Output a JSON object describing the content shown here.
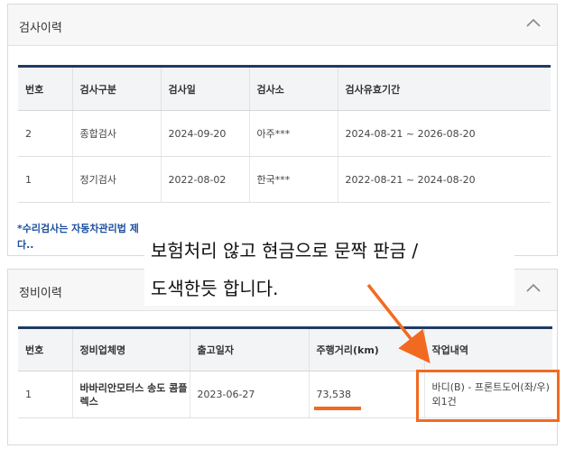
{
  "inspection": {
    "title": "검사이력",
    "columns": [
      "번호",
      "검사구분",
      "검사일",
      "검사소",
      "검사유효기간"
    ],
    "rows": [
      {
        "no": "2",
        "type": "종합검사",
        "date": "2024-09-20",
        "station": "아주***",
        "valid": "2024-08-21 ~ 2026-08-20"
      },
      {
        "no": "1",
        "type": "정기검사",
        "date": "2022-08-02",
        "station": "한국***",
        "valid": "2022-08-21 ~ 2024-08-20"
      }
    ],
    "notice_line1": "*수리검사는 자동차관리법 제",
    "notice_line2": "다.."
  },
  "maintenance": {
    "title": "정비이력",
    "columns": [
      "번호",
      "정비업체명",
      "출고일자",
      "주행거리(km)",
      "작업내역"
    ],
    "rows": [
      {
        "no": "1",
        "company": "바바리안모터스 송도 콤플렉스",
        "date": "2023-06-27",
        "mileage": "73,538",
        "work": "바디(B) - 프론트도어(좌/우) 외1건"
      }
    ]
  },
  "annotation": {
    "line1": "보험처리 않고 현금으로 문짝 판금 /",
    "line2": "도색한듯 합니다.",
    "accent": "#f26a21"
  },
  "colors": {
    "table_top_border": "#1f3b63",
    "notice_text": "#1d4f9c"
  }
}
